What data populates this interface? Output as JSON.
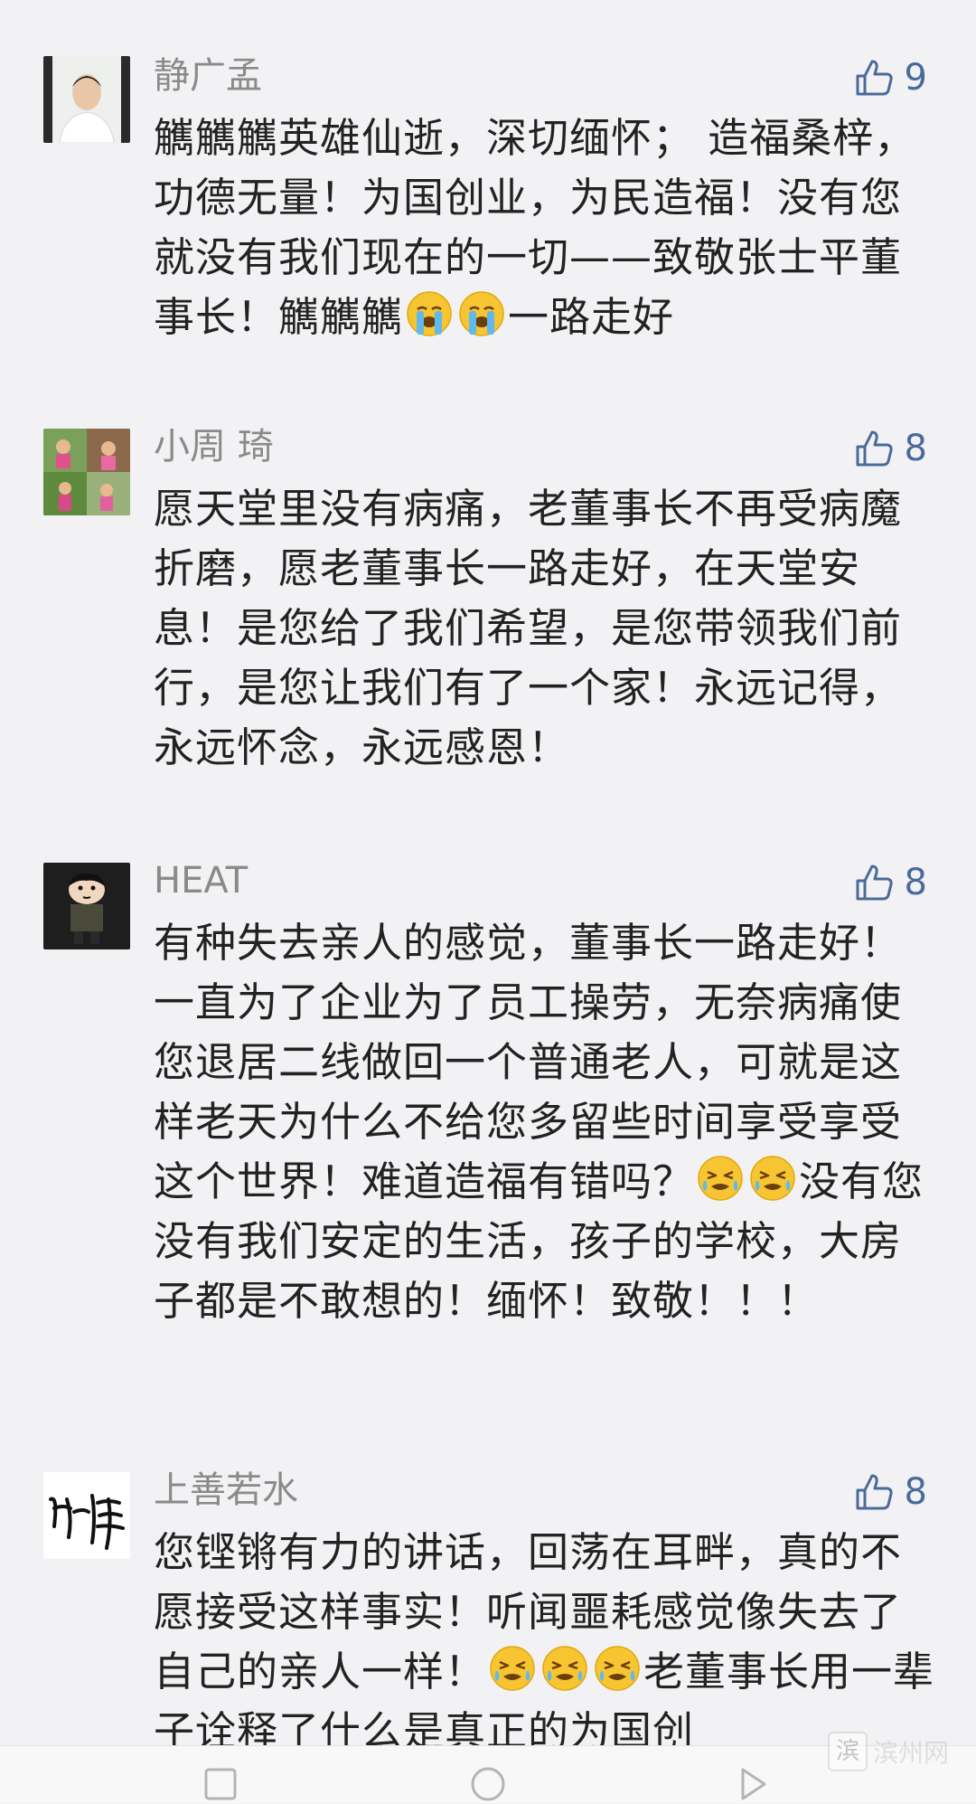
{
  "comments": [
    {
      "username": "静广孟",
      "likes": "9",
      "segments": [
        {
          "t": "text",
          "v": "觽觽觽英雄仙逝，深切缅怀； 造福桑梓，功德无量！为国创业，为民造福！没有您就没有我们现在的一切——致敬张士平董事长！觽觽觽"
        },
        {
          "t": "emoji",
          "icon": "crying-face-emoji"
        },
        {
          "t": "emoji",
          "icon": "crying-face-emoji"
        },
        {
          "t": "text",
          "v": "一路走好"
        }
      ]
    },
    {
      "username": "小周 琦",
      "likes": "8",
      "segments": [
        {
          "t": "text",
          "v": "愿天堂里没有病痛，老董事长不再受病魔折磨，愿老董事长一路走好，在天堂安息！是您给了我们希望，是您带领我们前行，是您让我们有了一个家！永远记得，永远怀念，永远感恩！"
        }
      ]
    },
    {
      "username": "HEAT",
      "likes": "8",
      "segments": [
        {
          "t": "text",
          "v": "有种失去亲人的感觉，董事长一路走好！一直为了企业为了员工操劳，无奈病痛使您退居二线做回一个普通老人，可就是这样老天为什么不给您多留些时间享受享受这个世界！难道造福有错吗？"
        },
        {
          "t": "emoji",
          "icon": "tears-face-emoji"
        },
        {
          "t": "emoji",
          "icon": "tears-face-emoji"
        },
        {
          "t": "text",
          "v": "没有您没有我们安定的生活，孩子的学校，大房子都是不敢想的！缅怀！致敬！！！"
        }
      ]
    },
    {
      "username": "上善若水",
      "likes": "8",
      "segments": [
        {
          "t": "text",
          "v": "您铿锵有力的讲话，回荡在耳畔，真的不愿接受这样事实！听闻噩耗感觉像失去了自己的亲人一样！"
        },
        {
          "t": "emoji",
          "icon": "tears-face-emoji"
        },
        {
          "t": "emoji",
          "icon": "tears-face-emoji"
        },
        {
          "t": "emoji",
          "icon": "tears-face-emoji"
        },
        {
          "t": "text",
          "v": "老董事长用一辈子诠释了什么是真正的为国创"
        }
      ]
    }
  ],
  "watermark": {
    "logo": "滨",
    "text": "滨州网"
  },
  "colors": {
    "background": "#f2f2f4",
    "username": "#8a8a8a",
    "like_accent": "#4a6a9a",
    "text": "#222222"
  },
  "icons": {
    "like": "thumbs-up-icon",
    "nav": [
      "back-icon",
      "home-icon",
      "forward-icon"
    ]
  }
}
